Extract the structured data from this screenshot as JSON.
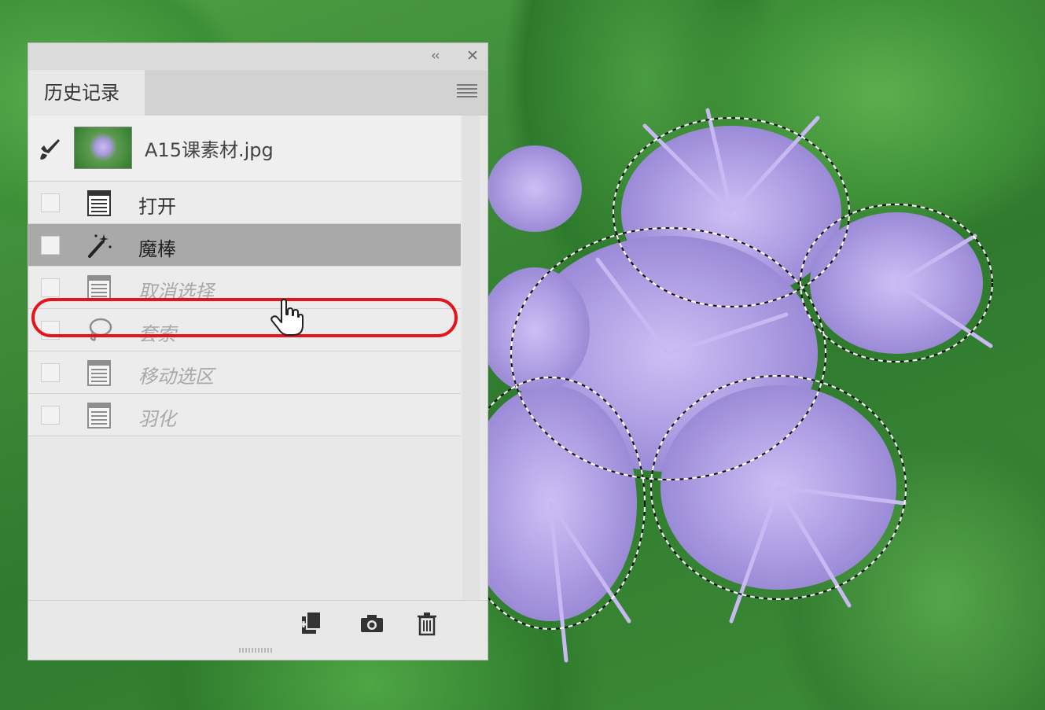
{
  "panel": {
    "tab_label": "历史记录",
    "snapshot": {
      "name": "A15课素材.jpg"
    },
    "history_items": [
      {
        "label": "打开",
        "icon": "document-icon",
        "state": "active"
      },
      {
        "label": "魔棒",
        "icon": "magic-wand-icon",
        "state": "selected"
      },
      {
        "label": "取消选择",
        "icon": "document-icon",
        "state": "undone"
      },
      {
        "label": "套索",
        "icon": "lasso-icon",
        "state": "undone"
      },
      {
        "label": "移动选区",
        "icon": "document-icon",
        "state": "undone"
      },
      {
        "label": "羽化",
        "icon": "document-icon",
        "state": "undone"
      }
    ]
  },
  "colors": {
    "highlight_ring": "#e3141c",
    "selected_row": "#a9a9a9",
    "panel_bg": "#e8e8e8",
    "flower": "#b8a8ea"
  }
}
